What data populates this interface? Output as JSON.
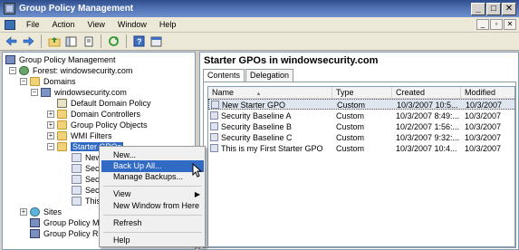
{
  "window": {
    "title": "Group Policy Management"
  },
  "window_buttons": {
    "minimize": "_",
    "restore": "□",
    "close": "✕"
  },
  "menubar": {
    "items": [
      "File",
      "Action",
      "View",
      "Window",
      "Help"
    ],
    "right_buttons": [
      "_",
      "▫",
      "✕"
    ]
  },
  "toolbar": {
    "icons": [
      "back-arrow-icon",
      "forward-arrow-icon",
      "up-folder-icon",
      "show-hide-tree-icon",
      "properties-icon",
      "refresh-icon",
      "help-icon",
      "console-icon"
    ]
  },
  "tree": {
    "root": "Group Policy Management",
    "forest": "Forest: windowsecurity.com",
    "domains": "Domains",
    "domain": "windowsecurity.com",
    "children": [
      "Default Domain Policy",
      "Domain Controllers",
      "Group Policy Objects",
      "WMI Filters"
    ],
    "starter": "Starter GPOs",
    "starter_children": [
      "New",
      "Secu",
      "Secu",
      "Secu",
      "This i"
    ],
    "sites": "Sites",
    "modeling": "Group Policy Mod",
    "results": "Group Policy Res"
  },
  "context_menu": {
    "items": [
      "New...",
      "Back Up All...",
      "Manage Backups...",
      "View",
      "New Window from Here",
      "Refresh",
      "Help"
    ],
    "highlighted": "Back Up All...",
    "submenu_arrow": "▶"
  },
  "right_pane": {
    "title": "Starter GPOs in windowsecurity.com",
    "tabs": [
      "Contents",
      "Delegation"
    ],
    "columns": [
      "Name",
      "Type",
      "Created",
      "Modified"
    ],
    "sort_arrow": "▲",
    "rows": [
      {
        "name": "New Starter GPO",
        "type": "Custom",
        "created": "10/3/2007 10:5...",
        "modified": "10/3/2007"
      },
      {
        "name": "Security Baseline A",
        "type": "Custom",
        "created": "10/3/2007 8:49:...",
        "modified": "10/3/2007"
      },
      {
        "name": "Security Baseline B",
        "type": "Custom",
        "created": "10/2/2007 1:56:...",
        "modified": "10/3/2007"
      },
      {
        "name": "Security Baseline C",
        "type": "Custom",
        "created": "10/3/2007 9:32:...",
        "modified": "10/3/2007"
      },
      {
        "name": "This is my First Starter GPO",
        "type": "Custom",
        "created": "10/3/2007 10:4...",
        "modified": "10/3/2007"
      }
    ]
  },
  "colors": {
    "title_bar": "#3a5a9c",
    "highlight": "#316ac5",
    "chrome": "#ece9d8"
  }
}
